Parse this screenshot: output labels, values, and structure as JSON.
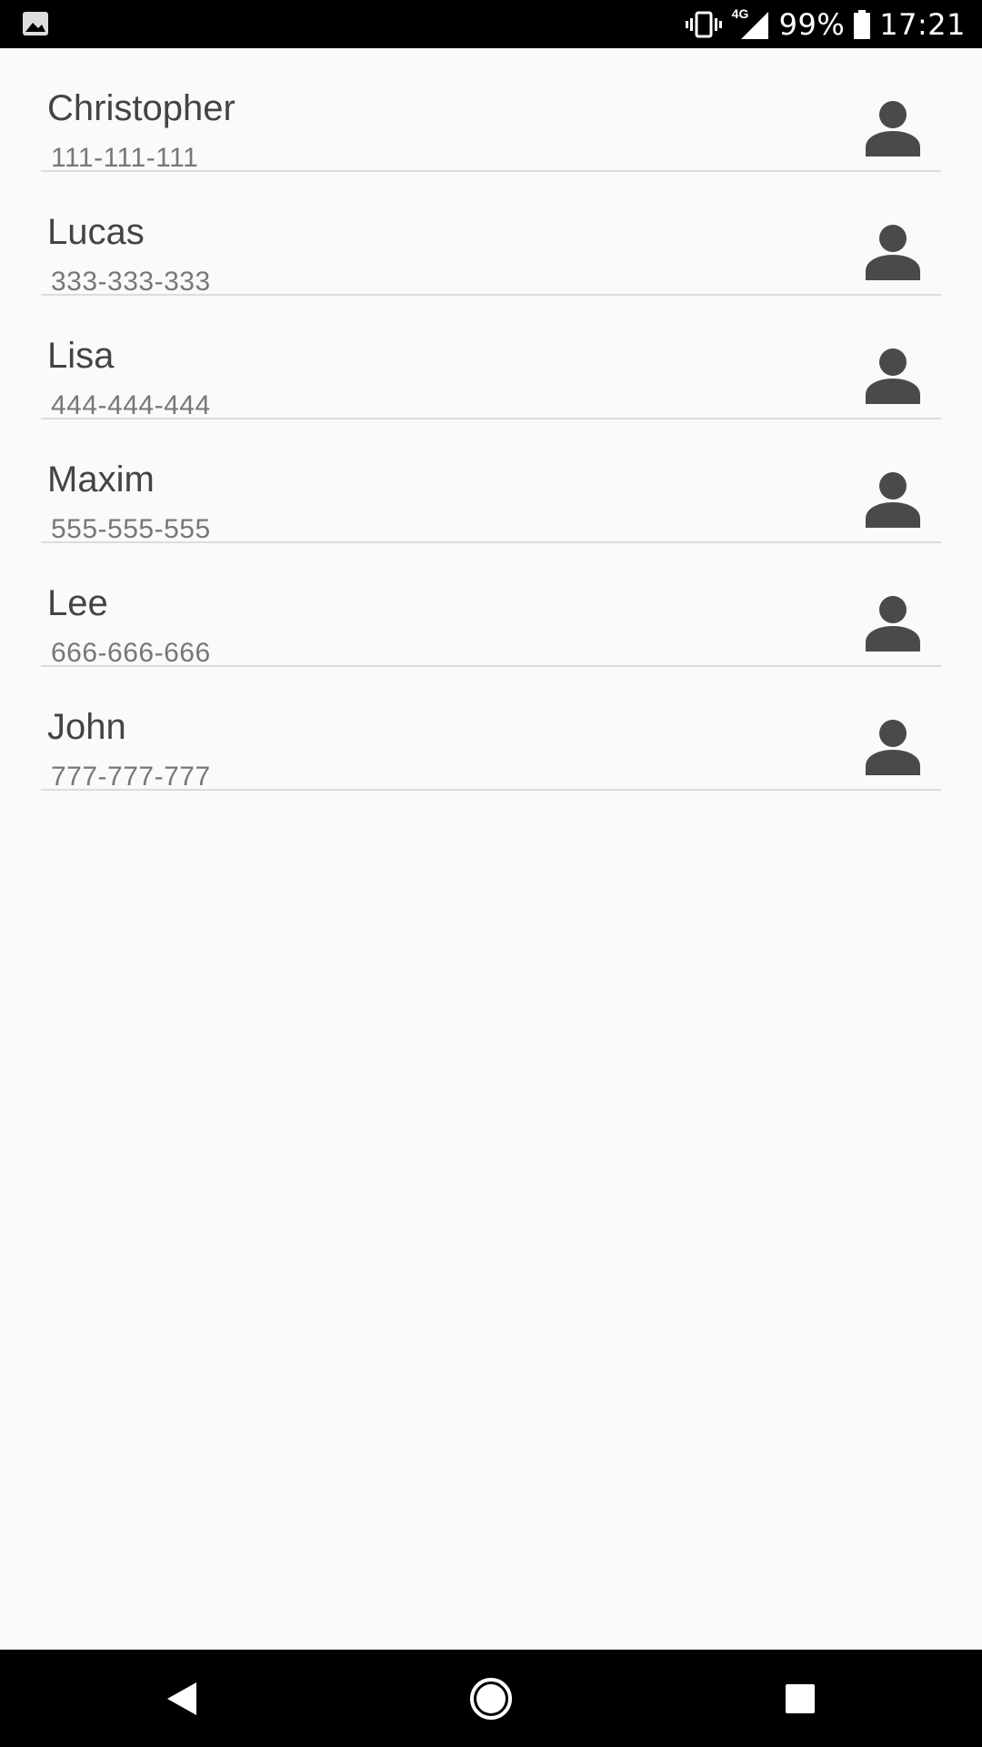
{
  "status_bar": {
    "network_label": "4G",
    "battery": "99%",
    "time": "17:21",
    "icons": [
      "image-icon",
      "vibrate-icon",
      "signal-icon",
      "battery-icon"
    ]
  },
  "contacts": [
    {
      "name": "Christopher",
      "phone": "111-111-111"
    },
    {
      "name": "Lucas",
      "phone": "333-333-333"
    },
    {
      "name": "Lisa",
      "phone": "444-444-444"
    },
    {
      "name": "Maxim",
      "phone": "555-555-555"
    },
    {
      "name": "Lee",
      "phone": "666-666-666"
    },
    {
      "name": "John",
      "phone": "777-777-777"
    }
  ],
  "nav_bar": {
    "icons": [
      "back-icon",
      "home-icon",
      "recents-icon"
    ]
  },
  "colors": {
    "background": "#fafafa",
    "text_primary": "#444444",
    "text_secondary": "#777777",
    "avatar": "#4a4a4a",
    "divider": "#dcdcdc"
  }
}
